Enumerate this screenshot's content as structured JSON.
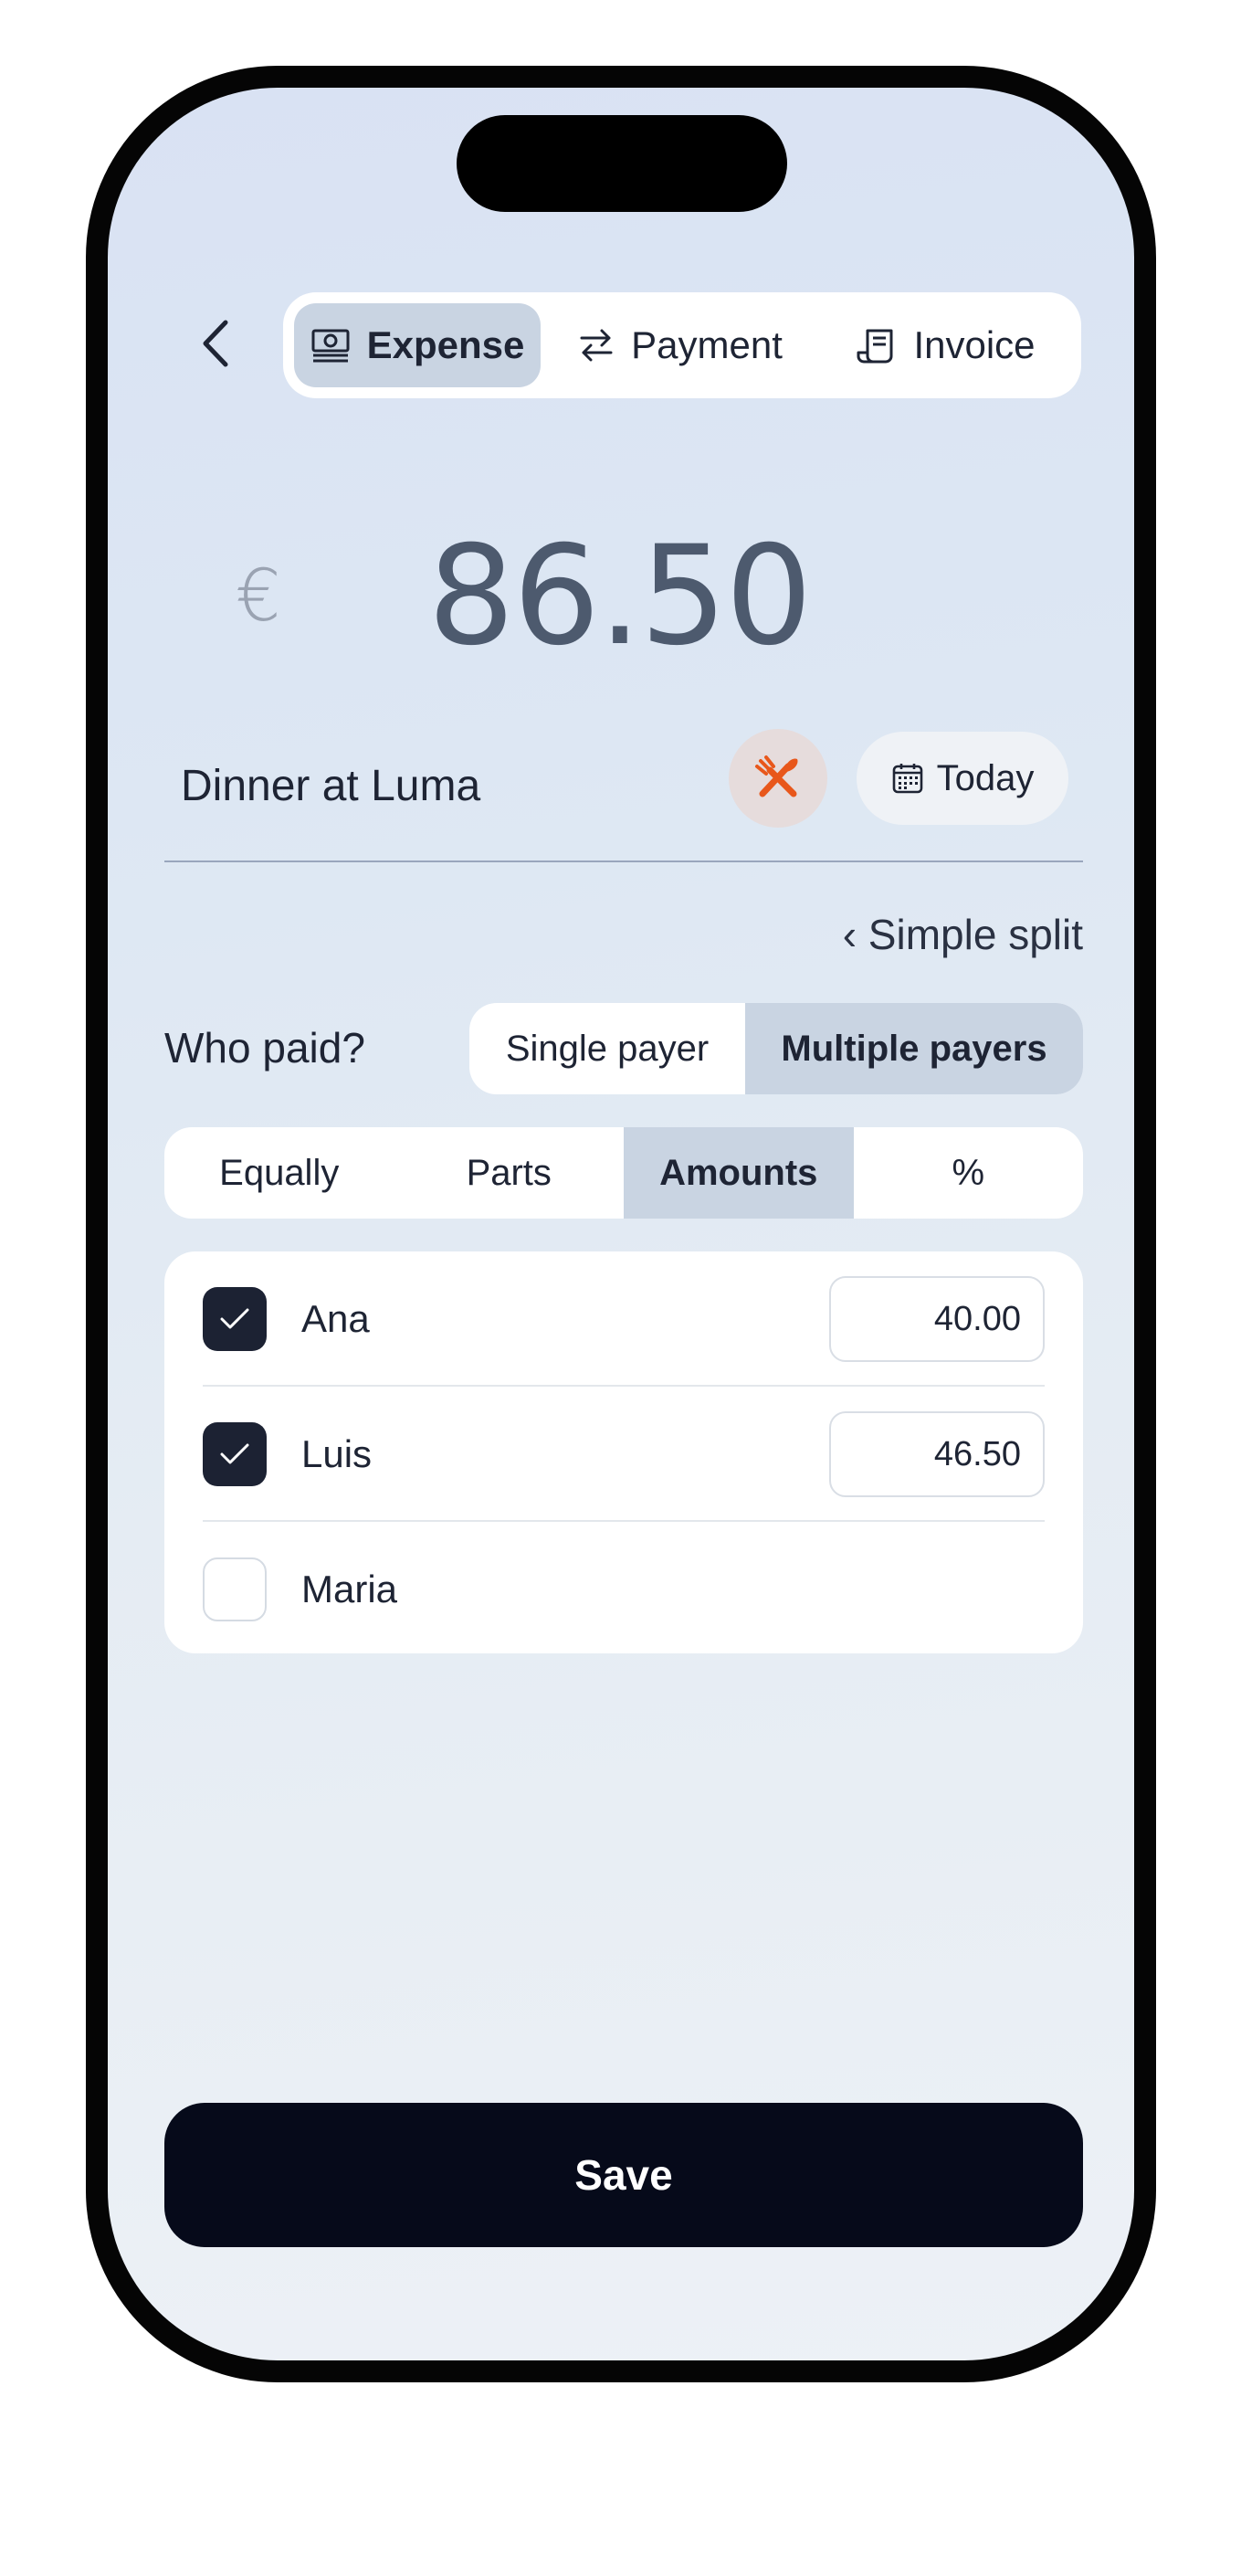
{
  "nav": {
    "tabs": [
      {
        "label": "Expense",
        "icon": "banknote-icon",
        "active": true
      },
      {
        "label": "Payment",
        "icon": "arrows-exchange-icon",
        "active": false
      },
      {
        "label": "Invoice",
        "icon": "receipt-icon",
        "active": false
      }
    ]
  },
  "expense": {
    "currency_symbol": "€",
    "amount": "86.50",
    "description": "Dinner at Luma",
    "category_icon": "fork-knife-icon",
    "date_label": "Today",
    "simple_split_link": "‹ Simple split"
  },
  "payers": {
    "question": "Who paid?",
    "options": [
      {
        "label": "Single payer",
        "active": false
      },
      {
        "label": "Multiple payers",
        "active": true
      }
    ],
    "split_modes": [
      {
        "label": "Equally",
        "active": false
      },
      {
        "label": "Parts",
        "active": false
      },
      {
        "label": "Amounts",
        "active": true
      },
      {
        "label": "%",
        "active": false
      }
    ],
    "people": [
      {
        "name": "Ana",
        "checked": true,
        "amount": "40.00"
      },
      {
        "name": "Luis",
        "checked": true,
        "amount": "46.50"
      },
      {
        "name": "Maria",
        "checked": false,
        "amount": ""
      }
    ]
  },
  "actions": {
    "save_label": "Save"
  },
  "colors": {
    "accent_dark": "#060a1a",
    "segment_active": "#c9d4e2",
    "category_icon": "#e8571b",
    "checkbox_on": "#1c2233"
  }
}
